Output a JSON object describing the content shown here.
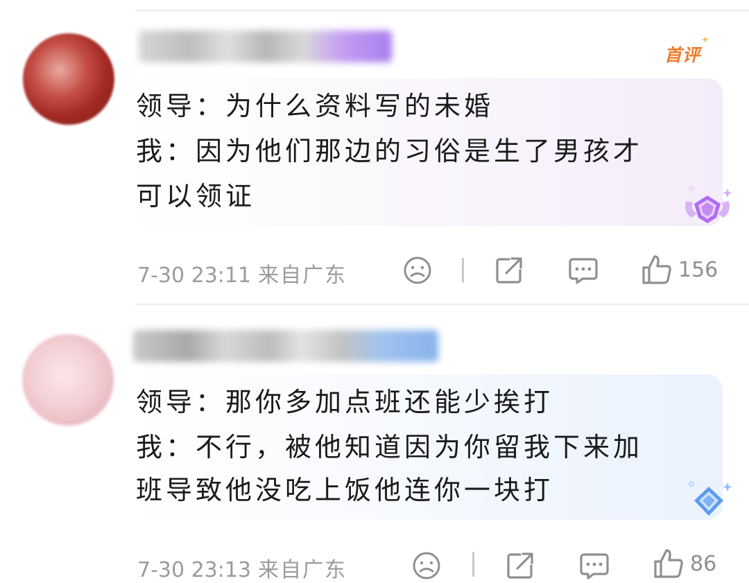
{
  "comments": [
    {
      "first_badge": "首评",
      "lines": [
        "领导：为什么资料写的未婚",
        "我：因为他们那边的习俗是生了男孩才",
        "可以领证"
      ],
      "time": "7-30 23:11",
      "location": "来自广东",
      "likes": "156",
      "badge_color": "#b06cf0"
    },
    {
      "lines": [
        "领导：那你多加点班还能少挨打",
        "我：不行，被他知道因为你留我下来加",
        "班导致他没吃上饭他连你一块打"
      ],
      "time": "7-30 23:13",
      "location": "来自广东",
      "likes": "86",
      "badge_color": "#5b9cf0"
    }
  ],
  "icons": [
    "sad-face-icon",
    "share-icon",
    "comment-icon",
    "thumbs-up-icon"
  ],
  "colors": {
    "first_badge": "#f07a2a",
    "meta_text": "#9b9b9b"
  }
}
